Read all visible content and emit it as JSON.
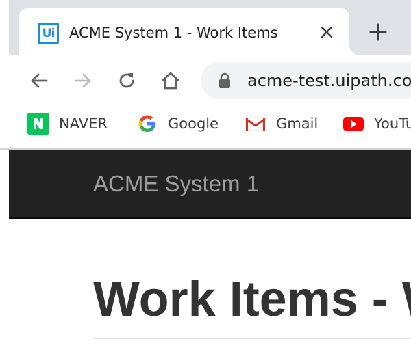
{
  "browser": {
    "tab": {
      "title": "ACME System 1 - Work Items",
      "favicon_text": "Ui",
      "favicon_color": "#1b8fd6"
    },
    "address_bar": {
      "url": "acme-test.uipath.com"
    },
    "bookmarks": [
      {
        "label": "NAVER",
        "icon": "naver-icon"
      },
      {
        "label": "Google",
        "icon": "google-icon"
      },
      {
        "label": "Gmail",
        "icon": "gmail-icon"
      },
      {
        "label": "YouTube",
        "icon": "youtube-icon"
      }
    ]
  },
  "site": {
    "brand": "ACME System 1",
    "navbar_color": "#222222",
    "heading": "Work Items - Work Items"
  }
}
